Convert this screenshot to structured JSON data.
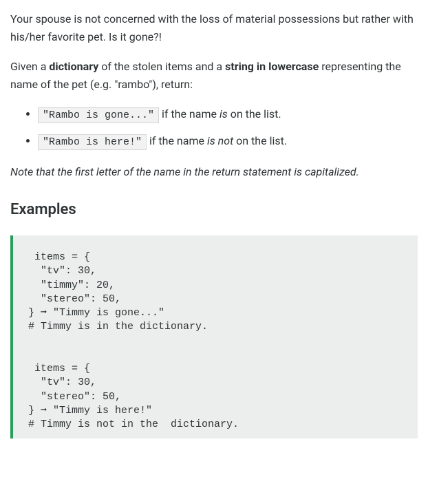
{
  "intro": {
    "paragraph1": "Your spouse is not concerned with the loss of material possessions but rather with his/her favorite pet. Is it gone?!",
    "paragraph2_prefix": "Given a ",
    "paragraph2_bold1": "dictionary",
    "paragraph2_mid": " of the stolen items and a ",
    "paragraph2_bold2": "string in lowercase",
    "paragraph2_suffix": " representing the name of the pet (e.g. \"rambo\"), return:"
  },
  "bullets": {
    "item1_code": "\"Rambo is gone...\"",
    "item1_text_pre": " if the name ",
    "item1_text_em": "is",
    "item1_text_post": " on the list.",
    "item2_code": "\"Rambo is here!\"",
    "item2_text_pre": " if the name ",
    "item2_text_em": "is not",
    "item2_text_post": " on the list."
  },
  "note": "Note that the first letter of the name in the return statement is capitalized.",
  "examples_heading": "Examples",
  "code_block": " items = {\n  \"tv\": 30,\n  \"timmy\": 20,\n  \"stereo\": 50,\n} ➞ \"Timmy is gone...\"\n# Timmy is in the dictionary.\n\n\n items = {\n  \"tv\": 30,\n  \"stereo\": 50,\n} ➞ \"Timmy is here!\"\n# Timmy is not in the  dictionary."
}
